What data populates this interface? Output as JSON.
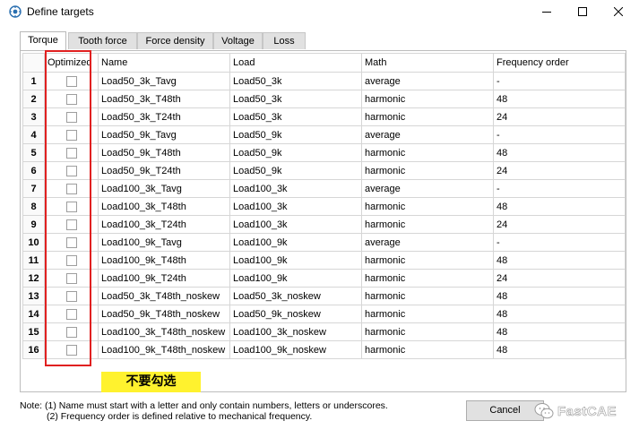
{
  "window": {
    "title": "Define targets",
    "icon": "app-gear-icon",
    "controls": [
      "minimize-icon",
      "maximize-icon",
      "close-icon"
    ]
  },
  "tabs": [
    {
      "label": "Torque",
      "active": true
    },
    {
      "label": "Tooth force",
      "active": false
    },
    {
      "label": "Force density",
      "active": false
    },
    {
      "label": "Voltage",
      "active": false
    },
    {
      "label": "Loss",
      "active": false
    }
  ],
  "table": {
    "columns": [
      "Optimized",
      "Name",
      "Load",
      "Math",
      "Frequency order"
    ],
    "rows": [
      {
        "num": "1",
        "checked": false,
        "name": "Load50_3k_Tavg",
        "load": "Load50_3k",
        "math": "average",
        "freq": "-"
      },
      {
        "num": "2",
        "checked": false,
        "name": "Load50_3k_T48th",
        "load": "Load50_3k",
        "math": "harmonic",
        "freq": "48"
      },
      {
        "num": "3",
        "checked": false,
        "name": "Load50_3k_T24th",
        "load": "Load50_3k",
        "math": "harmonic",
        "freq": "24"
      },
      {
        "num": "4",
        "checked": false,
        "name": "Load50_9k_Tavg",
        "load": "Load50_9k",
        "math": "average",
        "freq": "-"
      },
      {
        "num": "5",
        "checked": false,
        "name": "Load50_9k_T48th",
        "load": "Load50_9k",
        "math": "harmonic",
        "freq": "48"
      },
      {
        "num": "6",
        "checked": false,
        "name": "Load50_9k_T24th",
        "load": "Load50_9k",
        "math": "harmonic",
        "freq": "24"
      },
      {
        "num": "7",
        "checked": false,
        "name": "Load100_3k_Tavg",
        "load": "Load100_3k",
        "math": "average",
        "freq": "-"
      },
      {
        "num": "8",
        "checked": false,
        "name": "Load100_3k_T48th",
        "load": "Load100_3k",
        "math": "harmonic",
        "freq": "48"
      },
      {
        "num": "9",
        "checked": false,
        "name": "Load100_3k_T24th",
        "load": "Load100_3k",
        "math": "harmonic",
        "freq": "24"
      },
      {
        "num": "10",
        "checked": false,
        "name": "Load100_9k_Tavg",
        "load": "Load100_9k",
        "math": "average",
        "freq": "-"
      },
      {
        "num": "11",
        "checked": false,
        "name": "Load100_9k_T48th",
        "load": "Load100_9k",
        "math": "harmonic",
        "freq": "48"
      },
      {
        "num": "12",
        "checked": false,
        "name": "Load100_9k_T24th",
        "load": "Load100_9k",
        "math": "harmonic",
        "freq": "24"
      },
      {
        "num": "13",
        "checked": false,
        "name": "Load50_3k_T48th_noskew",
        "load": "Load50_3k_noskew",
        "math": "harmonic",
        "freq": "48"
      },
      {
        "num": "14",
        "checked": false,
        "name": "Load50_9k_T48th_noskew",
        "load": "Load50_9k_noskew",
        "math": "harmonic",
        "freq": "48"
      },
      {
        "num": "15",
        "checked": false,
        "name": "Load100_3k_T48th_noskew",
        "load": "Load100_3k_noskew",
        "math": "harmonic",
        "freq": "48"
      },
      {
        "num": "16",
        "checked": false,
        "name": "Load100_9k_T48th_noskew",
        "load": "Load100_9k_noskew",
        "math": "harmonic",
        "freq": "48"
      }
    ]
  },
  "annotation": {
    "text": "不要勾选",
    "highlight_color": "#fff22e",
    "box_color": "#e02020"
  },
  "notes": {
    "line1": "Note: (1) Name must start with a letter and only contain numbers, letters or underscores.",
    "line2": "(2) Frequency order is defined relative to mechanical frequency."
  },
  "buttons": {
    "cancel": "Cancel"
  },
  "watermark": {
    "icon": "wechat-icon",
    "text": "FastCAE"
  }
}
